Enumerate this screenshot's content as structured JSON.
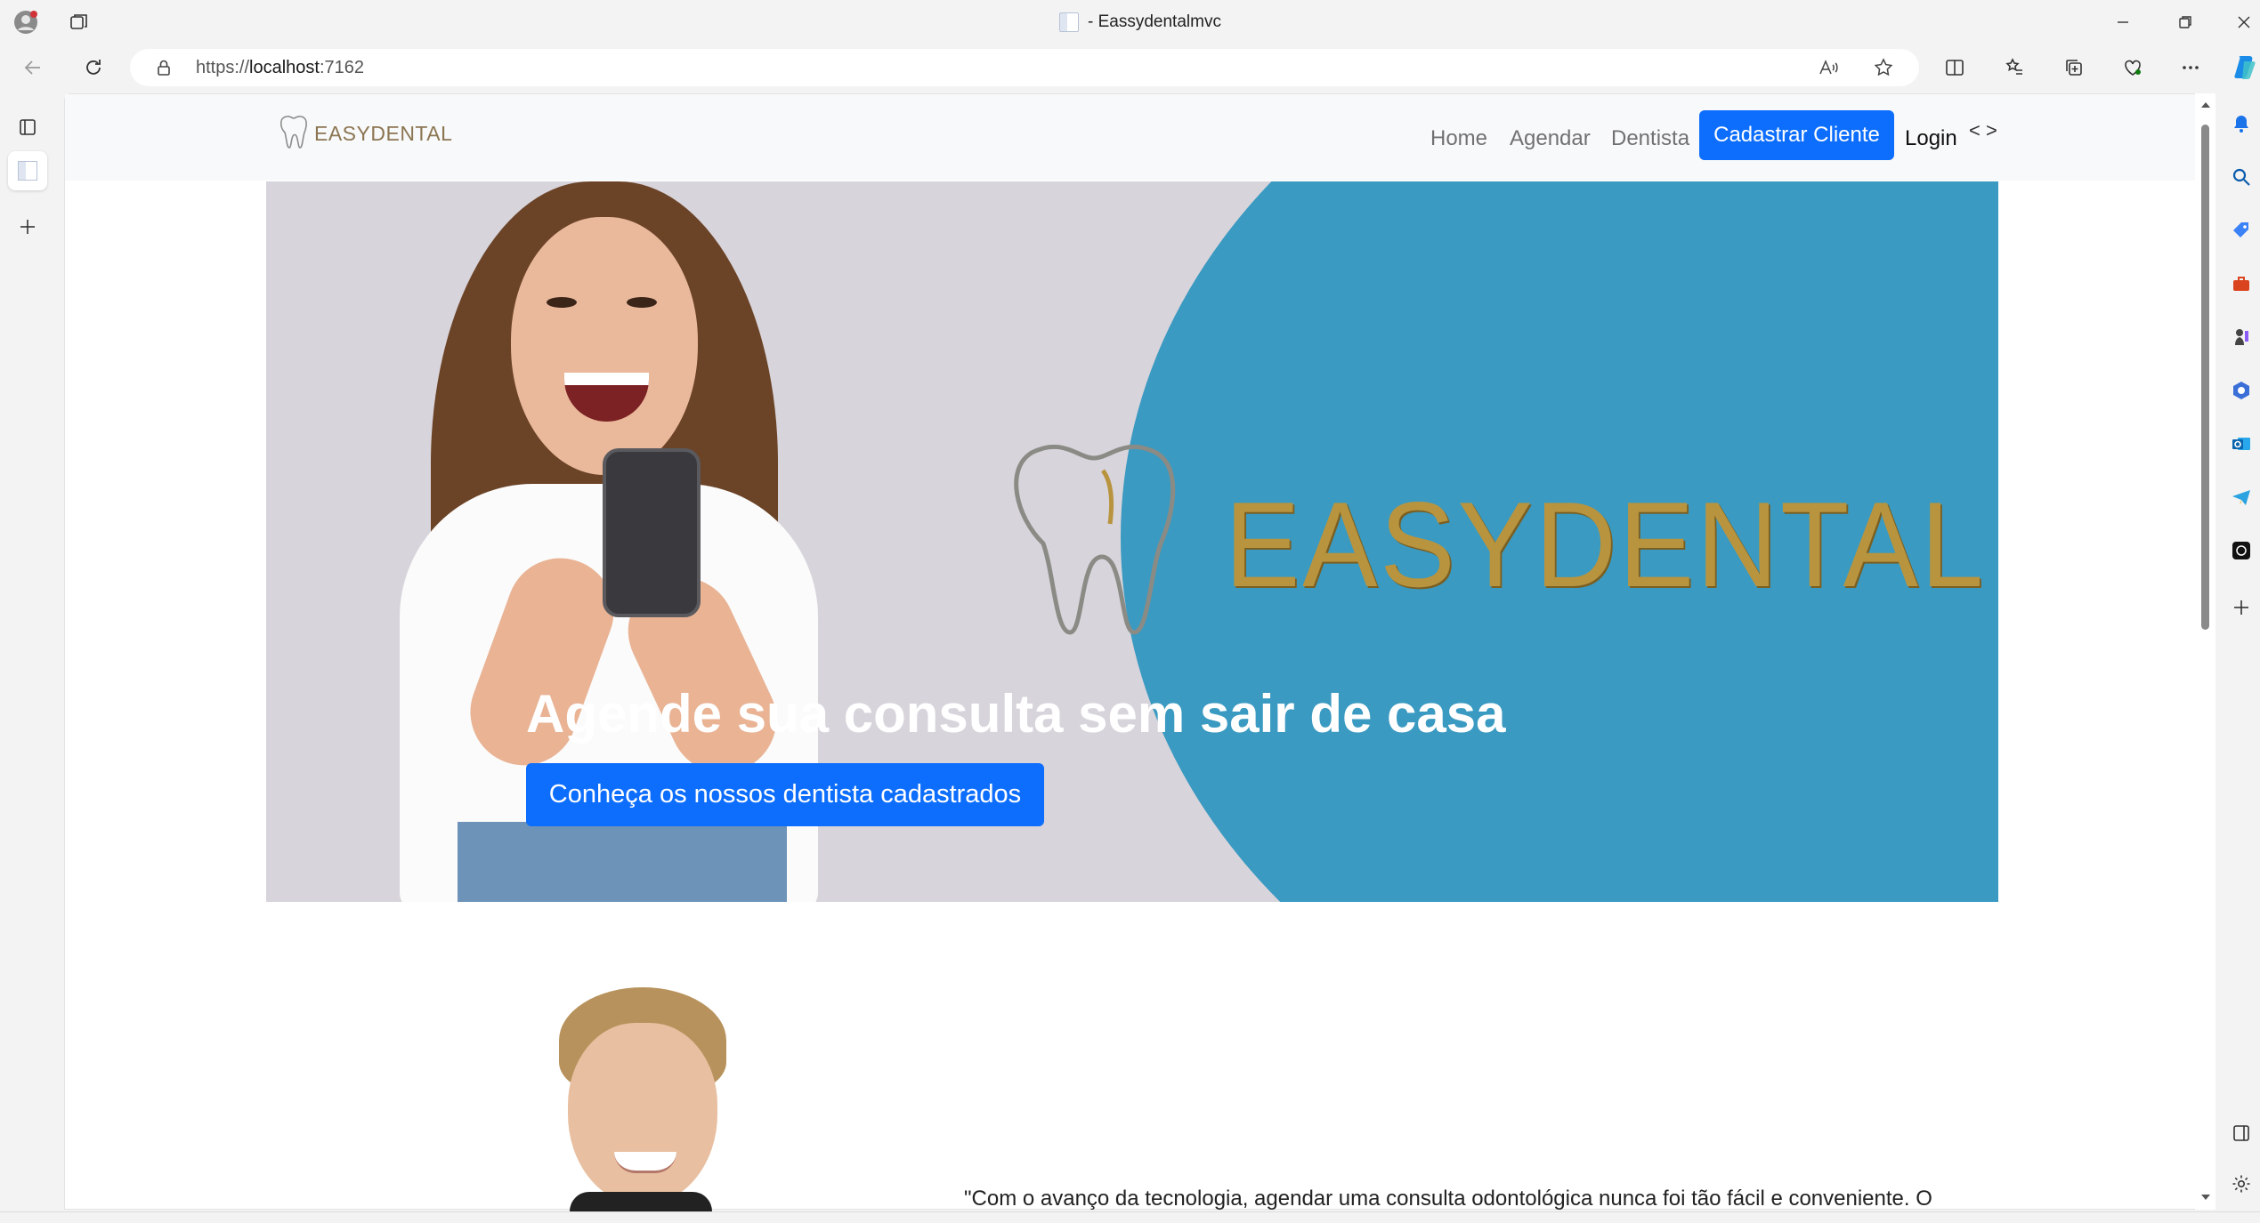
{
  "browser": {
    "tab_title": "- Eassydentalmvc",
    "url_scheme": "https://",
    "url_host": "localhost",
    "url_port": ":7162"
  },
  "site": {
    "brand": "EASYDENTAL",
    "nav": {
      "home": "Home",
      "agendar": "Agendar",
      "dentista": "Dentista",
      "cadastrar": "Cadastrar Cliente",
      "login": "Login",
      "code_glyph": "< >"
    },
    "hero": {
      "logo_text": "EASYDENTAL",
      "title": "Agende sua consulta sem sair de casa",
      "button": "Conheça os nossos dentista cadastrados"
    },
    "testimonial": {
      "quote": "\"Com o avanço da tecnologia, agendar uma consulta odontológica nunca foi tão fácil e conveniente. O"
    }
  },
  "colors": {
    "primary": "#0d6efd",
    "hero_blue": "#3a9ac1",
    "hero_bg": "#d8d4db",
    "brand_gold": "#b8943f"
  }
}
